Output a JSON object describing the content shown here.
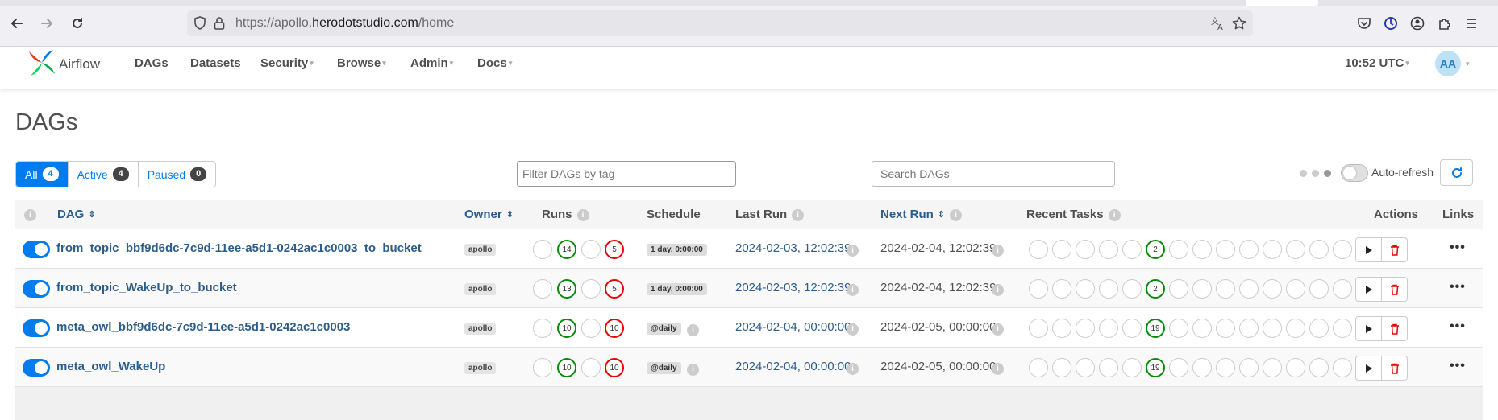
{
  "browser": {
    "url_prefix": "https://apollo.",
    "url_domain": "herodotstudio.com",
    "url_path": "/home"
  },
  "navbar": {
    "brand": "Airflow",
    "items": [
      {
        "label": "DAGs",
        "dropdown": false
      },
      {
        "label": "Datasets",
        "dropdown": false
      },
      {
        "label": "Security",
        "dropdown": true
      },
      {
        "label": "Browse",
        "dropdown": true
      },
      {
        "label": "Admin",
        "dropdown": true
      },
      {
        "label": "Docs",
        "dropdown": true
      }
    ],
    "time": "10:52 UTC",
    "avatar": "AA"
  },
  "page": {
    "title": "DAGs",
    "filters": [
      {
        "label": "All",
        "count": "4",
        "active": true
      },
      {
        "label": "Active",
        "count": "4",
        "active": false
      },
      {
        "label": "Paused",
        "count": "0",
        "active": false
      }
    ],
    "tag_filter_placeholder": "Filter DAGs by tag",
    "search_placeholder": "Search DAGs",
    "auto_refresh_label": "Auto-refresh"
  },
  "table": {
    "headers": {
      "dag": "DAG",
      "owner": "Owner",
      "runs": "Runs",
      "schedule": "Schedule",
      "last_run": "Last Run",
      "next_run": "Next Run",
      "recent_tasks": "Recent Tasks",
      "actions": "Actions",
      "links": "Links"
    },
    "rows": [
      {
        "name": "from_topic_bbf9d6dc-7c9d-11ee-a5d1-0242ac1c0003_to_bucket",
        "owner": "apollo",
        "runs_success": "14",
        "runs_failed": "5",
        "schedule": "1 day, 0:00:00",
        "schedule_info": false,
        "last_run": "2024-02-03, 12:02:39",
        "next_run": "2024-02-04, 12:02:39",
        "tasks_success": "2",
        "active": true
      },
      {
        "name": "from_topic_WakeUp_to_bucket",
        "owner": "apollo",
        "runs_success": "13",
        "runs_failed": "5",
        "schedule": "1 day, 0:00:00",
        "schedule_info": false,
        "last_run": "2024-02-03, 12:02:39",
        "next_run": "2024-02-04, 12:02:39",
        "tasks_success": "2",
        "active": true
      },
      {
        "name": "meta_owl_bbf9d6dc-7c9d-11ee-a5d1-0242ac1c0003",
        "owner": "apollo",
        "runs_success": "10",
        "runs_failed": "10",
        "schedule": "@daily",
        "schedule_info": true,
        "last_run": "2024-02-04, 00:00:00",
        "next_run": "2024-02-05, 00:00:00",
        "tasks_success": "19",
        "active": true
      },
      {
        "name": "meta_owl_WakeUp",
        "owner": "apollo",
        "runs_success": "10",
        "runs_failed": "10",
        "schedule": "@daily",
        "schedule_info": true,
        "last_run": "2024-02-04, 00:00:00",
        "next_run": "2024-02-05, 00:00:00",
        "tasks_success": "19",
        "active": true
      }
    ]
  },
  "colors": {
    "brand_blue": "#017cee",
    "link_blue": "#2c5c8a",
    "success_green": "#0a8a0a",
    "failed_red": "#e00000"
  }
}
